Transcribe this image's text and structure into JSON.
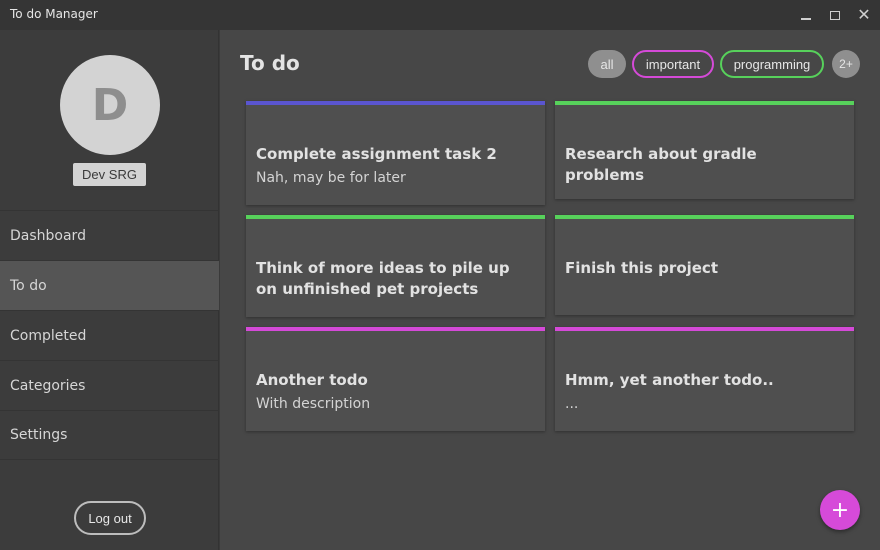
{
  "window": {
    "title": "To do Manager",
    "minimize_icon": "minimize-icon",
    "maximize_icon": "maximize-icon",
    "close_glyph": "✕"
  },
  "sidebar": {
    "avatar_letter": "D",
    "username": "Dev SRG",
    "items": [
      {
        "label": "Dashboard",
        "active": false
      },
      {
        "label": "To do",
        "active": true
      },
      {
        "label": "Completed",
        "active": false
      },
      {
        "label": "Categories",
        "active": false
      },
      {
        "label": "Settings",
        "active": false
      }
    ],
    "logout_label": "Log out"
  },
  "main": {
    "title": "To do",
    "filters": [
      {
        "label": "all",
        "style": "filled"
      },
      {
        "label": "important",
        "color": "#d54ad8"
      },
      {
        "label": "programming",
        "color": "#57d15b"
      }
    ],
    "more_filters": "2+",
    "todos": [
      {
        "title": "Complete assignment task 2",
        "description": "Nah, may be for later",
        "color": "#5a55d0"
      },
      {
        "title": "Research about gradle problems",
        "description": "",
        "color": "#57d15b"
      },
      {
        "title": "Think of more ideas to pile up on unfinished pet projects",
        "description": "",
        "color": "#57d15b"
      },
      {
        "title": "Finish this project",
        "description": "",
        "color": "#57d15b"
      },
      {
        "title": "Another todo",
        "description": "With description",
        "color": "#d54ad8"
      },
      {
        "title": "Hmm, yet another todo..",
        "description": "...",
        "color": "#d54ad8"
      }
    ],
    "add_button": "+"
  },
  "colors": {
    "accent": "#d64ad9",
    "important": "#d54ad8",
    "programming": "#57d15b",
    "default_category": "#5a55d0"
  }
}
